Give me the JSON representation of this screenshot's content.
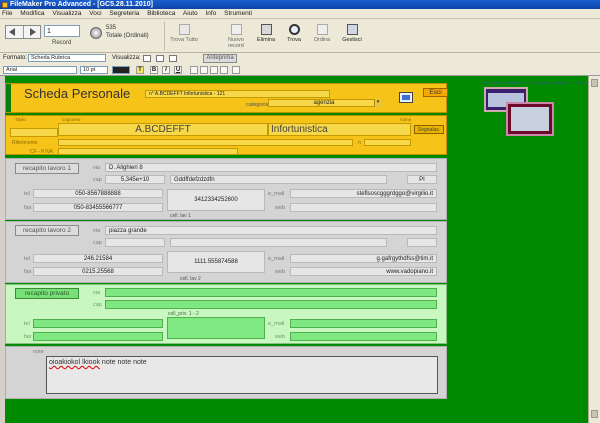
{
  "window": {
    "title": "FileMaker Pro Advanced - [GC5.28.11.2010]"
  },
  "menu": [
    "File",
    "Modifica",
    "Visualizza",
    "Voci",
    "Segreteria",
    "Biblioteca",
    "Aiuto",
    "Info",
    "Strumenti"
  ],
  "toolbar": {
    "record_value": "1",
    "record_label": "Record",
    "found_count": "535",
    "found_status": "Totale (Ordinati)",
    "buttons": [
      "Trova Tutto",
      "Nuovo record",
      "Elimina",
      "Trova",
      "Ordina",
      "Gestisci"
    ]
  },
  "formatbar": {
    "format_label": "Formato:",
    "layout": "Scheda Rubrica",
    "view_label": "Visualizza:",
    "preview_label": "Anteprima"
  },
  "stylebar": {
    "font": "Arial",
    "size": "10 pt",
    "btn_t": "T",
    "btn_b": "B",
    "btn_i": "I",
    "btn_u": "U"
  },
  "header": {
    "title": "Scheda Personale",
    "record_id": "n° A.BCDEFFT Infortunistica - 121",
    "category_label": "categoria",
    "category": "agenzia",
    "esci": "Esci",
    "thumb_text": "... GCProjects - DeskCen ... GCProjects - DeskCen ... GCProjects - DeskCen"
  },
  "name": {
    "titolo_label": "Titolo",
    "cognome_label": "cognome",
    "nome_label": "nome",
    "cognome": "A.BCDEFFT",
    "nome": "Infortunistica",
    "riferimento_label": "Riferimento",
    "cf_label": "CF - P.IVA",
    "n_label": "n",
    "segnalazioni": "Segnalaz."
  },
  "work1": {
    "btn": "recapito lavoro 1",
    "via_label": "via",
    "address": "D. Alighieri 8",
    "cap_label": "cap",
    "cap": "5,345e+10",
    "city": "Gddffdefzdzdfn",
    "prov": "PI",
    "tel_label": "tel",
    "tel": "050-8567888888",
    "fax_label": "fax",
    "fax": "050-83455566777",
    "cell": "3412334252600",
    "cell_label": "cell. lav 1",
    "email_label": "e_mail",
    "email": "steflsoscgggrdggo@virgilio.it",
    "web_label": "web",
    "web": ""
  },
  "work2": {
    "btn": "recapito lavoro 2",
    "via_label": "via",
    "address": "piazza grande",
    "cap_label": "cap",
    "tel_label": "tel",
    "tel": "246.21584",
    "fax_label": "fax",
    "fax": "0215.25568",
    "cell": "1111.555874588",
    "cell_label": "cell. lav 2",
    "email_label": "e_mail",
    "email": "g.gafrgythdfss@tim.it",
    "web_label": "web",
    "web": "www.vadopiano.it"
  },
  "private": {
    "btn": "recapito privato",
    "via_label": "via",
    "cap_label": "cap",
    "cell_label": "cell_priv. 1 - 2",
    "tel_label": "tel",
    "fax_label": "fax",
    "email_label": "e_mail",
    "web_label": "web"
  },
  "note": {
    "label": "note",
    "text_a": "oioakiokol lkiook",
    "text_b": " note note note"
  }
}
